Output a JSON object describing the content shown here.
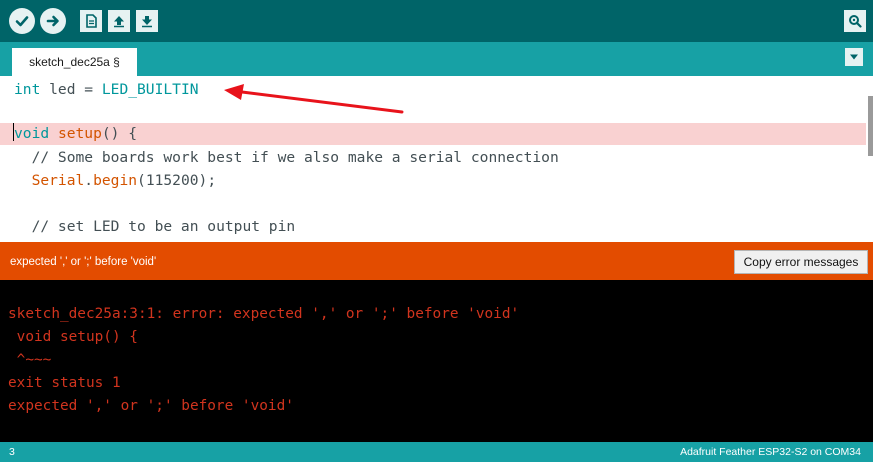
{
  "toolbar": {
    "buttons": [
      {
        "name": "verify-icon",
        "title": "Verify"
      },
      {
        "name": "upload-icon",
        "title": "Upload"
      },
      {
        "name": "new-icon",
        "title": "New"
      },
      {
        "name": "open-icon",
        "title": "Open"
      },
      {
        "name": "save-icon",
        "title": "Save"
      }
    ],
    "serial_monitor": {
      "name": "serial-monitor-icon"
    },
    "background": "#006468",
    "button_bg": "#e6f2f2"
  },
  "tabs": [
    {
      "label": "sketch_dec25a §"
    }
  ],
  "editor": {
    "lines": [
      {
        "type": "int",
        "rest": " led = ",
        "constant": "LED_BUILTIN"
      },
      {
        "text": ""
      },
      {
        "kw": "void",
        "fn": "setup",
        "rest": "() {",
        "highlighted": true
      },
      {
        "comment": "  // Some boards work best if we also make a serial connection"
      },
      {
        "indent": "  ",
        "obj": "Serial",
        "dot": ".",
        "fn": "begin",
        "rest": "(115200);"
      },
      {
        "text": ""
      },
      {
        "comment": "  // set LED to be an output pin"
      }
    ],
    "error_highlight": "#f9d1d1"
  },
  "status": {
    "message": "expected ',' or ';' before 'void'",
    "copy_button": "Copy error messages",
    "color": "#e34c00"
  },
  "console": {
    "lines": [
      "",
      "sketch_dec25a:3:1: error: expected ',' or ';' before 'void'",
      " void setup() {",
      " ^~~~",
      "exit status 1",
      "expected ',' or ';' before 'void'"
    ],
    "text_color": "#d1341e"
  },
  "footer": {
    "line_number": "3",
    "board": "Adafruit Feather ESP32-S2 on COM34"
  }
}
